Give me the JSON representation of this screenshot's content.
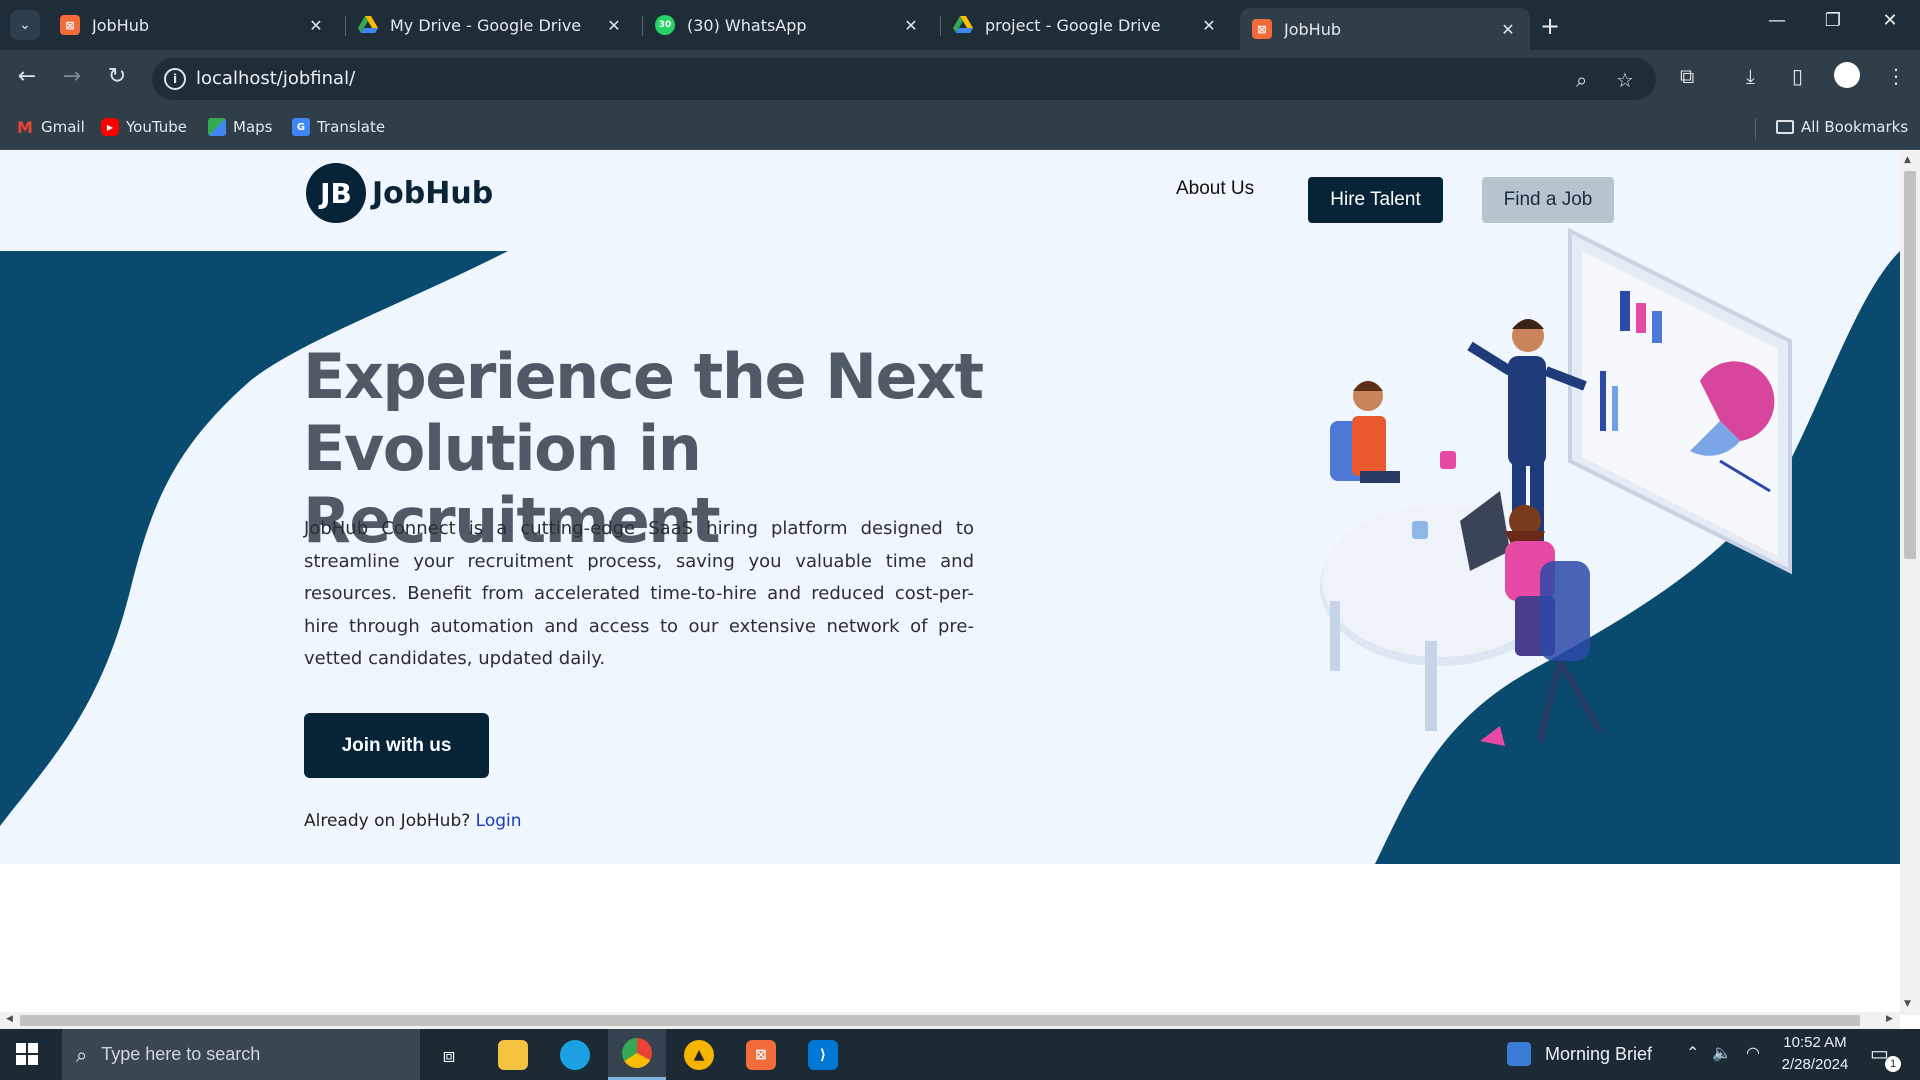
{
  "browser": {
    "tabs": [
      {
        "title": "JobHub",
        "icon": "xampp-icon",
        "active": false
      },
      {
        "title": "My Drive - Google Drive",
        "icon": "google-drive-icon",
        "active": false
      },
      {
        "title": "(30) WhatsApp",
        "icon": "whatsapp-icon",
        "active": false
      },
      {
        "title": "project - Google Drive",
        "icon": "google-drive-icon",
        "active": false
      },
      {
        "title": "JobHub",
        "icon": "xampp-icon",
        "active": true
      }
    ],
    "url": "localhost/jobfinal/",
    "bookmarks": [
      {
        "label": "Gmail",
        "icon": "gmail-icon"
      },
      {
        "label": "YouTube",
        "icon": "youtube-icon"
      },
      {
        "label": "Maps",
        "icon": "maps-icon"
      },
      {
        "label": "Translate",
        "icon": "translate-icon"
      }
    ],
    "all_bookmarks": "All Bookmarks",
    "whatsapp_badge": "30"
  },
  "site": {
    "brand": "JobHub",
    "nav": {
      "about": "About Us",
      "hire": "Hire Talent",
      "find": "Find a Job"
    },
    "hero": {
      "headline_line1": "Experience the Next",
      "headline_line2": "Evolution in Recruitment",
      "description": "JobHub Connect is a cutting-edge SaaS hiring platform designed to streamline your recruitment process, saving you valuable time and resources. Benefit from accelerated time-to-hire and reduced cost-per-hire through automation and access to our extensive network of pre-vetted candidates, updated daily.",
      "cta": "Join with us",
      "already_text": "Already on JobHub?",
      "login_link": "Login"
    },
    "colors": {
      "navy": "#062338",
      "wave": "#0a4a6e",
      "hero_bg": "#eff6fd",
      "headline": "#4f5a66"
    }
  },
  "taskbar": {
    "search_placeholder": "Type here to search",
    "news_widget": "Morning Brief",
    "time": "10:52 AM",
    "date": "2/28/2024",
    "notification_count": "1"
  }
}
